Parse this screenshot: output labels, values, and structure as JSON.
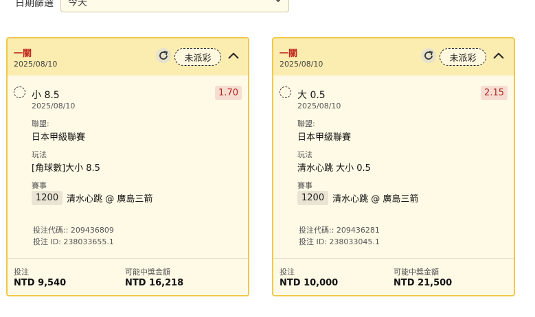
{
  "filter": {
    "label": "日期篩選",
    "value": "今天"
  },
  "cards": [
    {
      "stage": "一關",
      "date": "2025/08/10",
      "status": "未派彩",
      "selection": "小 8.5",
      "odds": "1.70",
      "selection_date": "2025/08/10",
      "league_label": "聯盟:",
      "league": "日本甲級聯賽",
      "market_label": "玩法",
      "market": "[角球數]大小 8.5",
      "event_label": "賽事",
      "match_id": "1200",
      "match": "清水心跳 @ 廣島三箭",
      "bet_code": "投注代碼:: 209436809",
      "bet_id": "投注 ID: 238033655.1",
      "stake_label": "投注",
      "stake": "NTD 9,540",
      "payout_label": "可能中獎金額",
      "payout": "NTD 16,218"
    },
    {
      "stage": "一關",
      "date": "2025/08/10",
      "status": "未派彩",
      "selection": "大 0.5",
      "odds": "2.15",
      "selection_date": "2025/08/10",
      "league_label": "聯盟:",
      "league": "日本甲級聯賽",
      "market_label": "玩法",
      "market": "清水心跳 大小 0.5",
      "event_label": "賽事",
      "match_id": "1200",
      "match": "清水心跳 @ 廣島三箭",
      "bet_code": "投注代碼:: 209436281",
      "bet_id": "投注 ID: 238033045.1",
      "stake_label": "投注",
      "stake": "NTD 10,000",
      "payout_label": "可能中獎金額",
      "payout": "NTD 21,500"
    }
  ],
  "colors": {
    "border": "#f0c94a",
    "header_bg": "#fbecb0",
    "card_bg": "#fffae6",
    "stage_red": "#c0271f",
    "odds_bg": "#f6ddd2"
  },
  "icons": [
    "chevron-down-icon",
    "refresh-icon",
    "chevron-up-icon",
    "radio-icon"
  ]
}
